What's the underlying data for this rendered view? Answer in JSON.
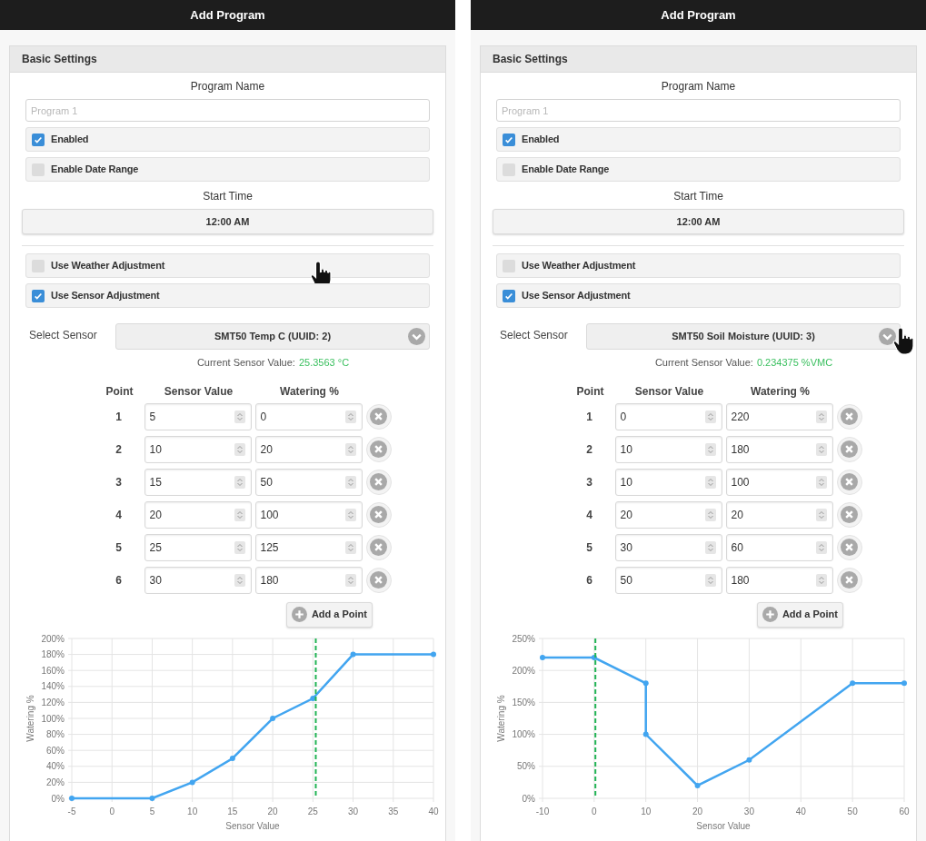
{
  "panels": [
    {
      "title": "Add Program",
      "section": "Basic Settings",
      "program_name_label": "Program Name",
      "program_name": {
        "placeholder": "Program 1"
      },
      "checkboxes": [
        {
          "label": "Enabled",
          "checked": true
        },
        {
          "label": "Enable Date Range",
          "checked": false
        }
      ],
      "start_time_label": "Start Time",
      "start_time": "12:00 AM",
      "adjustments": [
        {
          "label": "Use Weather Adjustment",
          "checked": false,
          "hovered": true
        },
        {
          "label": "Use Sensor Adjustment",
          "checked": true,
          "hovered": false
        }
      ],
      "sensor": {
        "label": "Select Sensor",
        "value": "SMT50 Temp C (UUID: 2)",
        "hovered": false,
        "current_label": "Current Sensor Value:",
        "current_value": "25.3563 °C"
      },
      "columns": [
        "Point",
        "Sensor Value",
        "Watering %"
      ],
      "rows": [
        {
          "point": "1",
          "sensor_value": "5",
          "watering": "0"
        },
        {
          "point": "2",
          "sensor_value": "10",
          "watering": "20"
        },
        {
          "point": "3",
          "sensor_value": "15",
          "watering": "50"
        },
        {
          "point": "4",
          "sensor_value": "20",
          "watering": "100"
        },
        {
          "point": "5",
          "sensor_value": "25",
          "watering": "125"
        },
        {
          "point": "6",
          "sensor_value": "30",
          "watering": "180"
        }
      ],
      "add_button": "Add a Point",
      "chart_data": {
        "type": "line",
        "xlabel": "Sensor Value",
        "ylabel": "Watering %",
        "x": [
          -5,
          5,
          10,
          15,
          20,
          25,
          30,
          40
        ],
        "series": [
          {
            "color": "#42a5f0",
            "marker": "circle",
            "values": [
              0,
              0,
              20,
              50,
              100,
              125,
              180,
              180
            ]
          }
        ],
        "grid": true,
        "xlim": [
          -5,
          40
        ],
        "ylim": [
          0,
          200
        ],
        "xticks": [
          -5,
          0,
          5,
          10,
          15,
          20,
          25,
          30,
          35,
          40
        ],
        "yticks": [
          {
            "value": 0,
            "label": "0%"
          },
          {
            "value": 20,
            "label": "20%"
          },
          {
            "value": 40,
            "label": "40%"
          },
          {
            "value": 60,
            "label": "60%"
          },
          {
            "value": 80,
            "label": "80%"
          },
          {
            "value": 100,
            "label": "100%"
          },
          {
            "value": 120,
            "label": "120%"
          },
          {
            "value": 140,
            "label": "140%"
          },
          {
            "value": 160,
            "label": "160%"
          },
          {
            "value": 180,
            "label": "180%"
          },
          {
            "value": 200,
            "label": "200%"
          }
        ],
        "ref_lines": [
          {
            "axis": "x",
            "value": 25.3563,
            "color": "#22b455"
          }
        ]
      }
    },
    {
      "title": "Add Program",
      "section": "Basic Settings",
      "program_name_label": "Program Name",
      "program_name": {
        "placeholder": "Program 1"
      },
      "checkboxes": [
        {
          "label": "Enabled",
          "checked": true
        },
        {
          "label": "Enable Date Range",
          "checked": false
        }
      ],
      "start_time_label": "Start Time",
      "start_time": "12:00 AM",
      "adjustments": [
        {
          "label": "Use Weather Adjustment",
          "checked": false,
          "hovered": false
        },
        {
          "label": "Use Sensor Adjustment",
          "checked": true,
          "hovered": false
        }
      ],
      "sensor": {
        "label": "Select Sensor",
        "value": "SMT50 Soil Moisture (UUID: 3)",
        "hovered": true,
        "current_label": "Current Sensor Value:",
        "current_value": "0.234375 %VMC"
      },
      "columns": [
        "Point",
        "Sensor Value",
        "Watering %"
      ],
      "rows": [
        {
          "point": "1",
          "sensor_value": "0",
          "watering": "220"
        },
        {
          "point": "2",
          "sensor_value": "10",
          "watering": "180"
        },
        {
          "point": "3",
          "sensor_value": "10",
          "watering": "100"
        },
        {
          "point": "4",
          "sensor_value": "20",
          "watering": "20"
        },
        {
          "point": "5",
          "sensor_value": "30",
          "watering": "60"
        },
        {
          "point": "6",
          "sensor_value": "50",
          "watering": "180"
        }
      ],
      "add_button": "Add a Point",
      "chart_data": {
        "type": "line",
        "xlabel": "Sensor Value",
        "ylabel": "Watering %",
        "x": [
          -10,
          0,
          10,
          10,
          20,
          30,
          50,
          60
        ],
        "series": [
          {
            "color": "#42a5f0",
            "marker": "circle",
            "values": [
              220,
              220,
              180,
              100,
              20,
              60,
              180,
              180
            ]
          }
        ],
        "grid": true,
        "xlim": [
          -10,
          60
        ],
        "ylim": [
          0,
          250
        ],
        "xticks": [
          -10,
          0,
          10,
          20,
          30,
          40,
          50,
          60
        ],
        "yticks": [
          {
            "value": 0,
            "label": "0%"
          },
          {
            "value": 50,
            "label": "50%"
          },
          {
            "value": 100,
            "label": "100%"
          },
          {
            "value": 150,
            "label": "150%"
          },
          {
            "value": 200,
            "label": "200%"
          },
          {
            "value": 250,
            "label": "250%"
          }
        ],
        "ref_lines": [
          {
            "axis": "x",
            "value": 0.234375,
            "color": "#22b455"
          }
        ]
      }
    }
  ]
}
